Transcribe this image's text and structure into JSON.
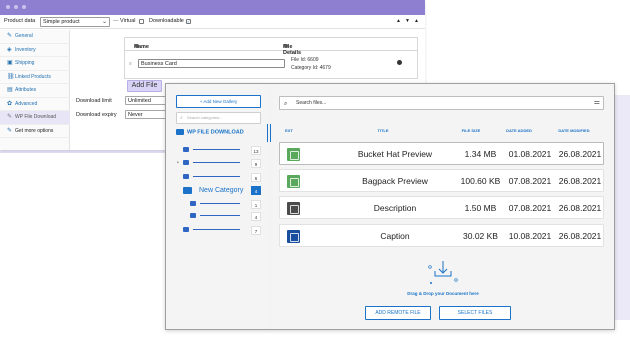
{
  "colors": {
    "accent": "#1a73c8",
    "titlebar": "#8e7fd1",
    "active_tab": "#e8e5f7",
    "add_file_bg": "#d9d3f5"
  },
  "product_data": {
    "label": "Product data",
    "type_value": "Simple product",
    "separator": "—",
    "virtual_label": "Virtual",
    "virtual_checked": false,
    "downloadable_label": "Downloadable",
    "downloadable_checked": true,
    "controls": [
      "▲",
      "▼",
      "▲"
    ]
  },
  "sidebar": {
    "items": [
      {
        "label": "General",
        "icon": "wrench-icon",
        "glyph": "✎",
        "active": false
      },
      {
        "label": "Inventory",
        "icon": "tag-icon",
        "glyph": "◈",
        "active": false
      },
      {
        "label": "Shipping",
        "icon": "truck-icon",
        "glyph": "▣",
        "active": false
      },
      {
        "label": "Linked Products",
        "icon": "link-icon",
        "glyph": "⛓",
        "active": false
      },
      {
        "label": "Attributes",
        "icon": "list-icon",
        "glyph": "▤",
        "active": false
      },
      {
        "label": "Advanced",
        "icon": "gear-icon",
        "glyph": "✿",
        "active": false
      },
      {
        "label": "WP File Download",
        "icon": "wrench-icon",
        "glyph": "✎",
        "active": true
      },
      {
        "label": "Get more options",
        "icon": "wrench-icon",
        "glyph": "✎",
        "active": false
      }
    ]
  },
  "file_table": {
    "col_name": "Name",
    "col_details": "File Details",
    "row_name": "Business Card",
    "row_file_id": "File Id: 6609",
    "row_category_id": "Category Id: 4679",
    "add_file_label": "Add File"
  },
  "download": {
    "limit_label": "Download limit",
    "limit_value": "Unlimited",
    "expiry_label": "Download expiry",
    "expiry_value": "Never"
  },
  "modal": {
    "add_gallery_label": "+ Add New Gallery",
    "search_categories_placeholder": "Search categories...",
    "root_label": "WP FILE DOWNLOAD",
    "tree": [
      {
        "count": "13",
        "indent": 0,
        "bullet": false
      },
      {
        "count": "9",
        "indent": 0,
        "bullet": true
      },
      {
        "count": "6",
        "indent": 0,
        "bullet": false
      },
      {
        "count": "4",
        "indent": 0,
        "label": "New Category",
        "active": true
      },
      {
        "count": "1",
        "indent": 1
      },
      {
        "count": "4",
        "indent": 1
      },
      {
        "count": "7",
        "indent": 0
      }
    ],
    "search_files_placeholder": "Search files...",
    "columns": [
      "EXT",
      "TITLE",
      "FILE SIZE",
      "DATE ADDED",
      "DATE MODIFIED"
    ],
    "files": [
      {
        "title": "Bucket Hat Preview",
        "size": "1.34 MB",
        "added": "01.08.2021",
        "modified": "26.08.2021",
        "ext_color": "#5aa85c",
        "ext_icon": "image-file-icon"
      },
      {
        "title": "Bagpack Preview",
        "size": "100.60 KB",
        "added": "07.08.2021",
        "modified": "26.08.2021",
        "ext_color": "#5aa85c",
        "ext_icon": "image-file-icon"
      },
      {
        "title": "Description",
        "size": "1.50 MB",
        "added": "07.08.2021",
        "modified": "26.08.2021",
        "ext_color": "#4b4b4b",
        "ext_icon": "video-file-icon"
      },
      {
        "title": "Caption",
        "size": "30.02 KB",
        "added": "10.08.2021",
        "modified": "26.08.2021",
        "ext_color": "#1a4fa0",
        "ext_icon": "word-file-icon"
      }
    ],
    "drag_text": "Drag & Drop your Document here",
    "remote_file_label": "ADD REMOTE FILE",
    "select_files_label": "SELECT FILES"
  }
}
